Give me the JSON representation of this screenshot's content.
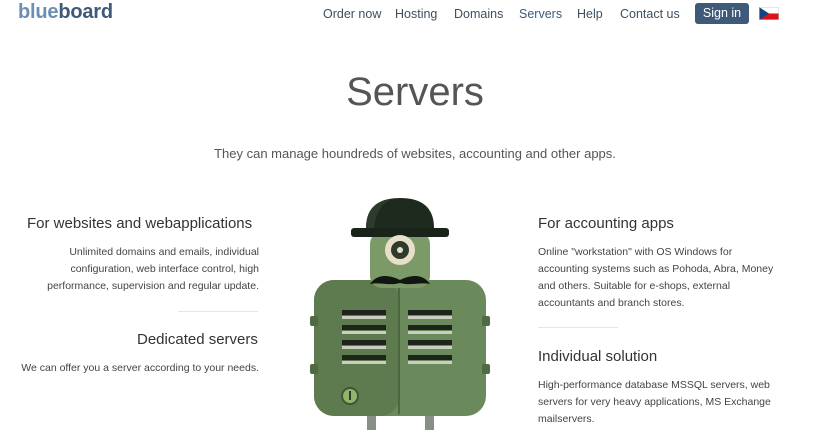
{
  "header": {
    "logo": {
      "part1": "blue",
      "part2": "board"
    },
    "nav": [
      "Order now",
      "Hosting",
      "Domains",
      "Servers",
      "Help",
      "Contact us"
    ],
    "signin": "Sign in",
    "language_flag": "czech-flag-icon",
    "active": "Servers"
  },
  "hero": {
    "title": "Servers",
    "subtitle": "They can manage houndreds of websites, accounting and other apps."
  },
  "features": {
    "left": [
      {
        "title": "For websites and webapplications",
        "lines": [
          "Unlimited domains and emails, individual",
          "configuration, web interface control, high",
          "performance, supervision and regular update."
        ]
      },
      {
        "title": "Dedicated servers",
        "lines": [
          "We can offer you a server according to your needs."
        ]
      }
    ],
    "right": [
      {
        "title": "For accounting apps",
        "lines": [
          "Online \"workstation\" with OS Windows for",
          "accounting systems such as Pohoda, Abra, Money",
          "and others. Suitable for e-shops, external",
          "accountants and branch stores."
        ]
      },
      {
        "title": "Individual solution",
        "lines": [
          "High-performance database MSSQL servers, web",
          "servers for very heavy applications, MS Exchange",
          "mailservers."
        ]
      }
    ]
  },
  "colors": {
    "brand_light": "#6a8fb3",
    "brand_dark": "#3d5a78",
    "button": "#3f5a78",
    "robot_green": "#6b8a5c",
    "robot_dark": "#2f3a2c"
  }
}
